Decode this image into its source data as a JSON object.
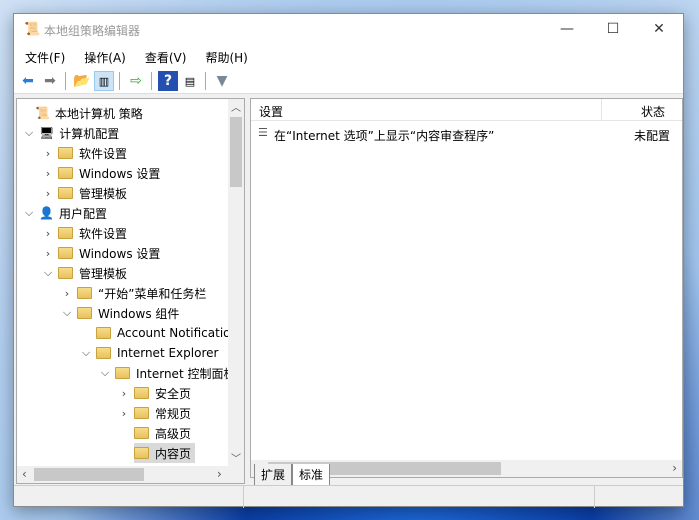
{
  "window": {
    "title": "本地组策略编辑器",
    "minimize": "—",
    "maximize": "☐",
    "close": "✕"
  },
  "menu": [
    "文件(F)",
    "操作(A)",
    "查看(V)",
    "帮助(H)"
  ],
  "tree": [
    {
      "label": "本地计算机 策略",
      "level": 0,
      "chevron": "",
      "icon": "policy"
    },
    {
      "label": "计算机配置",
      "level": 0,
      "chevron": "down",
      "icon": "computer"
    },
    {
      "label": "软件设置",
      "level": 1,
      "chevron": "right",
      "icon": "folder"
    },
    {
      "label": "Windows 设置",
      "level": 1,
      "chevron": "right",
      "icon": "folder"
    },
    {
      "label": "管理模板",
      "level": 1,
      "chevron": "right",
      "icon": "folder"
    },
    {
      "label": "用户配置",
      "level": 0,
      "chevron": "down",
      "icon": "user"
    },
    {
      "label": "软件设置",
      "level": 1,
      "chevron": "right",
      "icon": "folder"
    },
    {
      "label": "Windows 设置",
      "level": 1,
      "chevron": "right",
      "icon": "folder"
    },
    {
      "label": "管理模板",
      "level": 1,
      "chevron": "down",
      "icon": "folder"
    },
    {
      "label": "“开始”菜单和任务栏",
      "level": 2,
      "chevron": "right",
      "icon": "folder"
    },
    {
      "label": "Windows 组件",
      "level": 2,
      "chevron": "down",
      "icon": "folder"
    },
    {
      "label": "Account Notifications",
      "level": 3,
      "chevron": "",
      "icon": "folder"
    },
    {
      "label": "Internet Explorer",
      "level": 3,
      "chevron": "down",
      "icon": "folder"
    },
    {
      "label": "Internet 控制面板",
      "level": 4,
      "chevron": "down",
      "icon": "folder"
    },
    {
      "label": "安全页",
      "level": 5,
      "chevron": "right",
      "icon": "folder"
    },
    {
      "label": "常规页",
      "level": 5,
      "chevron": "right",
      "icon": "folder"
    },
    {
      "label": "高级页",
      "level": 5,
      "chevron": "",
      "icon": "folder"
    },
    {
      "label": "内容页",
      "level": 5,
      "chevron": "",
      "icon": "folder",
      "selected": true
    }
  ],
  "list": {
    "columns": [
      "设置",
      "状态"
    ],
    "rows": [
      {
        "setting": "在“Internet 选项”上显示“内容审查程序”",
        "state": "未配置"
      }
    ]
  },
  "tabs": [
    "扩展",
    "标准"
  ]
}
